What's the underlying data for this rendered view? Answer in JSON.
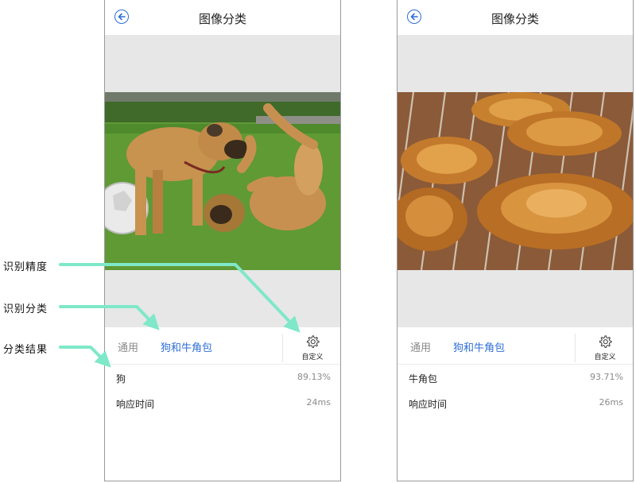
{
  "screens": [
    {
      "title": "图像分类",
      "tabs": {
        "general": "通用",
        "active": "狗和牛角包"
      },
      "custom_label": "自定义",
      "result": {
        "label": "狗",
        "confidence": "89.13%"
      },
      "timing": {
        "label": "响应时间",
        "value": "24ms"
      },
      "image": "photo of two dogs playing on grass with a soccer ball"
    },
    {
      "title": "图像分类",
      "tabs": {
        "general": "通用",
        "active": "狗和牛角包"
      },
      "custom_label": "自定义",
      "result": {
        "label": "牛角包",
        "confidence": "93.71%"
      },
      "timing": {
        "label": "响应时间",
        "value": "26ms"
      },
      "image": "photo of croissants on a cooling rack"
    }
  ],
  "annotations": {
    "precision": "识别精度",
    "category": "识别分类",
    "result": "分类结果"
  },
  "icons": {
    "back": "back-arrow-icon",
    "settings": "gear-icon"
  },
  "colors": {
    "accent": "#2f6fd6",
    "annotation_arrow": "#7ee8c8",
    "gray_band": "#e7e7e7"
  }
}
